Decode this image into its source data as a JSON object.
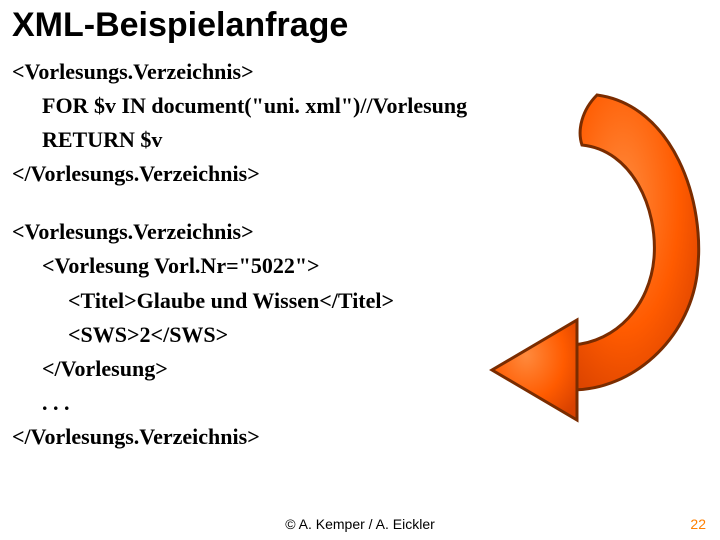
{
  "title": "XML-Beispielanfrage",
  "query": {
    "open": "<Vorlesungs.Verzeichnis>",
    "line1": "FOR $v IN document(\"uni. xml\")//Vorlesung",
    "line2": "RETURN $v",
    "close": "</Vorlesungs.Verzeichnis>"
  },
  "result": {
    "open": "<Vorlesungs.Verzeichnis>",
    "vl_open": "<Vorlesung Vorl.Nr=\"5022\">",
    "titel": "<Titel>Glaube und Wissen</Titel>",
    "sws": "<SWS>2</SWS>",
    "vl_close": "</Vorlesung>",
    "ellipsis": ". . .",
    "close": "</Vorlesungs.Verzeichnis>"
  },
  "footer": {
    "center": "© A. Kemper / A. Eickler",
    "pageNumber": "22"
  },
  "colors": {
    "arrowFill": "#ff5b00",
    "arrowStroke": "#7a2c00"
  }
}
